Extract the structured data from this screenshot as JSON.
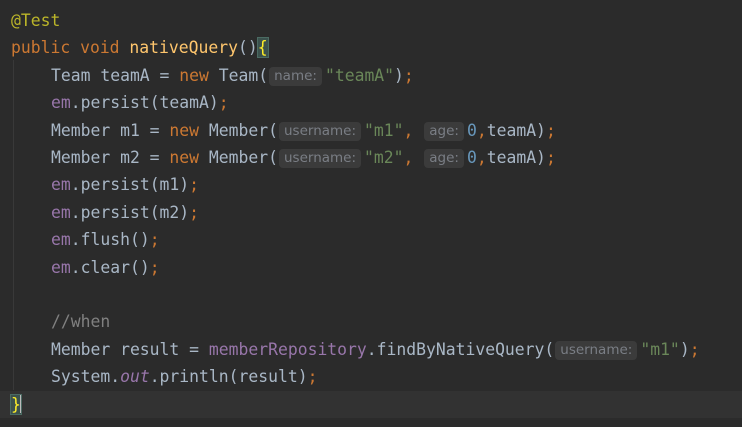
{
  "editor": {
    "lines": [
      {
        "segments": [
          {
            "t": "@Test",
            "c": "ann"
          }
        ]
      },
      {
        "segments": [
          {
            "t": "public ",
            "c": "kw"
          },
          {
            "t": "void ",
            "c": "kw"
          },
          {
            "t": "nativeQuery",
            "c": "fn"
          },
          {
            "t": "()",
            "c": "plain"
          },
          {
            "t": "{",
            "c": "brace"
          }
        ]
      },
      {
        "indent": true,
        "segments": [
          {
            "t": "Team teamA = ",
            "c": "plain"
          },
          {
            "t": "new ",
            "c": "kw"
          },
          {
            "t": "Team(",
            "c": "plain"
          },
          {
            "t": "name:",
            "c": "hint"
          },
          {
            "t": "\"teamA\"",
            "c": "str"
          },
          {
            "t": ")",
            "c": "plain"
          },
          {
            "t": ";",
            "c": "kw"
          }
        ]
      },
      {
        "indent": true,
        "segments": [
          {
            "t": "em",
            "c": "field"
          },
          {
            "t": ".persist(teamA)",
            "c": "plain"
          },
          {
            "t": ";",
            "c": "kw"
          }
        ]
      },
      {
        "indent": true,
        "segments": [
          {
            "t": "Member m1 = ",
            "c": "plain"
          },
          {
            "t": "new ",
            "c": "kw"
          },
          {
            "t": "Member(",
            "c": "plain"
          },
          {
            "t": "username:",
            "c": "hint"
          },
          {
            "t": "\"m1\"",
            "c": "str"
          },
          {
            "t": ", ",
            "c": "kw"
          },
          {
            "t": "age:",
            "c": "hint"
          },
          {
            "t": "0",
            "c": "num"
          },
          {
            "t": ",",
            "c": "kw"
          },
          {
            "t": "teamA)",
            "c": "plain"
          },
          {
            "t": ";",
            "c": "kw"
          }
        ]
      },
      {
        "indent": true,
        "segments": [
          {
            "t": "Member m2 = ",
            "c": "plain"
          },
          {
            "t": "new ",
            "c": "kw"
          },
          {
            "t": "Member(",
            "c": "plain"
          },
          {
            "t": "username:",
            "c": "hint"
          },
          {
            "t": "\"m2\"",
            "c": "str"
          },
          {
            "t": ", ",
            "c": "kw"
          },
          {
            "t": "age:",
            "c": "hint"
          },
          {
            "t": "0",
            "c": "num"
          },
          {
            "t": ",",
            "c": "kw"
          },
          {
            "t": "teamA)",
            "c": "plain"
          },
          {
            "t": ";",
            "c": "kw"
          }
        ]
      },
      {
        "indent": true,
        "segments": [
          {
            "t": "em",
            "c": "field"
          },
          {
            "t": ".persist(m1)",
            "c": "plain"
          },
          {
            "t": ";",
            "c": "kw"
          }
        ]
      },
      {
        "indent": true,
        "segments": [
          {
            "t": "em",
            "c": "field"
          },
          {
            "t": ".persist(m2)",
            "c": "plain"
          },
          {
            "t": ";",
            "c": "kw"
          }
        ]
      },
      {
        "indent": true,
        "segments": [
          {
            "t": "em",
            "c": "field"
          },
          {
            "t": ".flush()",
            "c": "plain"
          },
          {
            "t": ";",
            "c": "kw"
          }
        ]
      },
      {
        "indent": true,
        "segments": [
          {
            "t": "em",
            "c": "field"
          },
          {
            "t": ".clear()",
            "c": "plain"
          },
          {
            "t": ";",
            "c": "kw"
          }
        ]
      },
      {
        "indent": true,
        "segments": []
      },
      {
        "indent": true,
        "segments": [
          {
            "t": "//when",
            "c": "comment"
          }
        ]
      },
      {
        "indent": true,
        "segments": [
          {
            "t": "Member result = ",
            "c": "plain"
          },
          {
            "t": "memberRepository",
            "c": "field"
          },
          {
            "t": ".findByNativeQuery(",
            "c": "plain"
          },
          {
            "t": "username:",
            "c": "hint"
          },
          {
            "t": "\"m1\"",
            "c": "str"
          },
          {
            "t": ")",
            "c": "plain"
          },
          {
            "t": ";",
            "c": "kw"
          }
        ]
      },
      {
        "indent": true,
        "segments": [
          {
            "t": "System.",
            "c": "plain"
          },
          {
            "t": "out",
            "c": "static-field"
          },
          {
            "t": ".println(result)",
            "c": "plain"
          },
          {
            "t": ";",
            "c": "kw"
          }
        ]
      },
      {
        "current": true,
        "segments": [
          {
            "t": "}",
            "c": "brace"
          },
          {
            "t": "",
            "c": "caret"
          }
        ]
      }
    ]
  },
  "theme": {
    "background": "#2b2b2b",
    "current_line": "#323232",
    "keyword": "#cc7832",
    "annotation": "#bbb529",
    "method_decl": "#ffc66d",
    "string": "#6a8759",
    "number": "#6897bb",
    "field": "#9876aa",
    "comment": "#808080",
    "plain": "#a9b7c6"
  }
}
